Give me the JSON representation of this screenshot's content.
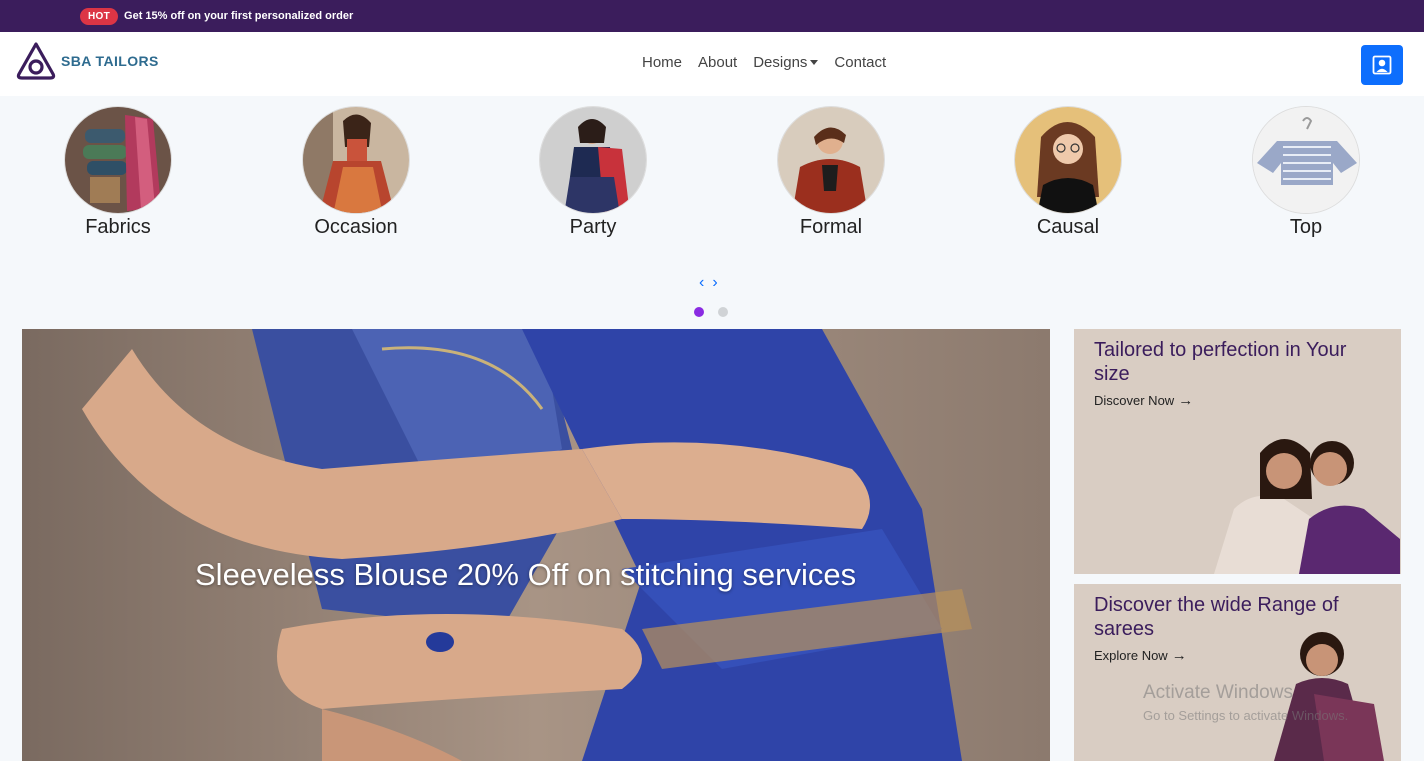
{
  "promo_bar": {
    "badge": "HOT",
    "text": "Get 15% off on your first personalized order"
  },
  "navbar": {
    "brand": "SBA TAILORS",
    "links": [
      {
        "label": "Home"
      },
      {
        "label": "About"
      },
      {
        "label": "Designs",
        "has_dropdown": true
      },
      {
        "label": "Contact"
      }
    ],
    "account_icon": "user-icon",
    "accent_color": "#0d6efd"
  },
  "categories": {
    "items": [
      {
        "label": "Fabrics"
      },
      {
        "label": "Occasion"
      },
      {
        "label": "Party"
      },
      {
        "label": "Formal"
      },
      {
        "label": "Causal"
      },
      {
        "label": "Top"
      }
    ],
    "prev_arrow": "‹",
    "next_arrow": "›",
    "dots_total": 2,
    "dots_active": 1
  },
  "hero": {
    "caption": "Sleeveless Blouse 20% Off on stitching services"
  },
  "side_promos": [
    {
      "title": "Tailored to perfection in Your size",
      "link": "Discover Now"
    },
    {
      "title": "Discover the wide Range of sarees",
      "link": "Explore Now"
    }
  ],
  "watermark": {
    "title": "Activate Windows",
    "subtitle": "Go to Settings to activate Windows."
  },
  "colors": {
    "promo_bar_bg": "#3b1d5c",
    "hot_badge": "#dc3545",
    "brand": "#2e6b8f",
    "dot_active": "#8a2be2",
    "promo_card_bg": "#d9cdc3"
  }
}
